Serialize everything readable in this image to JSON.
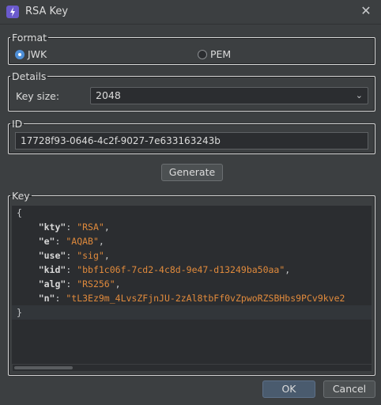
{
  "window": {
    "title": "RSA Key"
  },
  "format": {
    "legend": "Format",
    "options": [
      {
        "label": "JWK",
        "checked": true
      },
      {
        "label": "PEM",
        "checked": false
      }
    ]
  },
  "details": {
    "legend": "Details",
    "key_size_label": "Key size:",
    "key_size_value": "2048"
  },
  "id_group": {
    "legend": "ID",
    "value": "17728f93-0646-4c2f-9027-7e633163243b"
  },
  "generate_label": "Generate",
  "key_group": {
    "legend": "Key",
    "open_brace": "{",
    "close_brace": "}",
    "fields": [
      {
        "key": "\"kty\"",
        "value": "\"RSA\""
      },
      {
        "key": "\"e\"",
        "value": "\"AQAB\""
      },
      {
        "key": "\"use\"",
        "value": "\"sig\""
      },
      {
        "key": "\"kid\"",
        "value": "\"bbf1c06f-7cd2-4c8d-9e47-d13249ba50aa\""
      },
      {
        "key": "\"alg\"",
        "value": "\"RS256\""
      },
      {
        "key": "\"n\"",
        "value": "\"tL3Ez9m_4LvsZFjnJU-2zAl8tbFf0vZpwoRZSBHbs9PCv9kve2"
      }
    ]
  },
  "footer": {
    "ok_label": "OK",
    "cancel_label": "Cancel"
  },
  "colors": {
    "accent": "#4e8fd7",
    "string": "#e08a3c",
    "background": "#3c3f41"
  }
}
